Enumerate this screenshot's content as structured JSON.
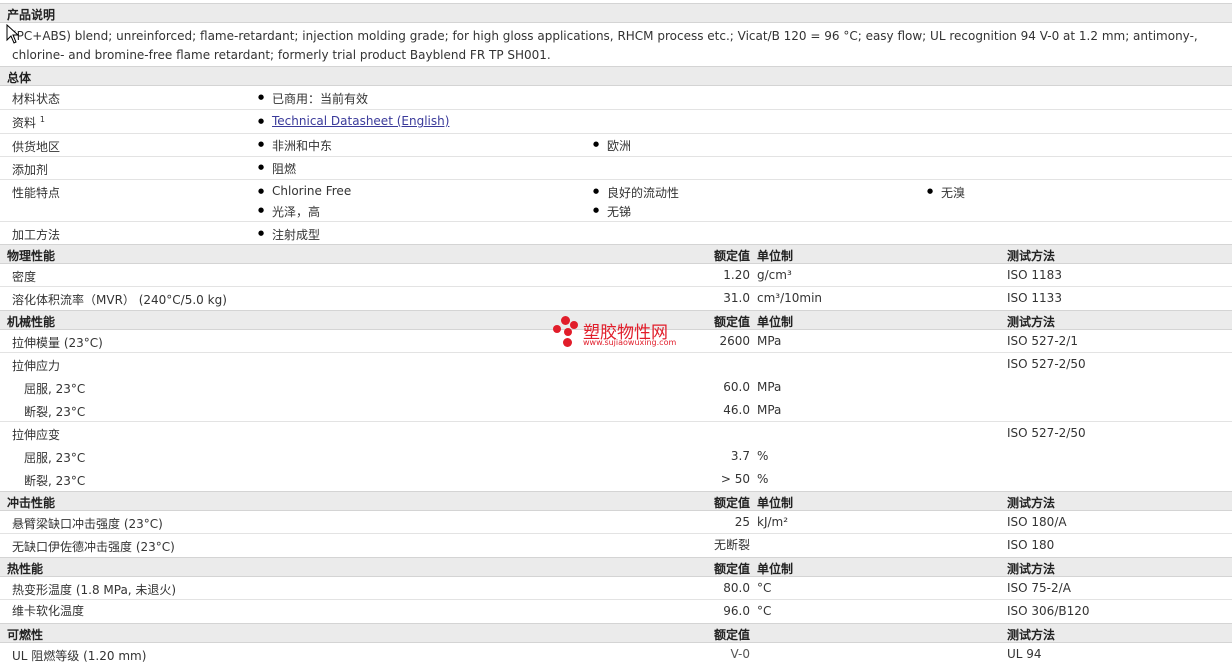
{
  "sections": {
    "desc_title": "产品说明",
    "desc_text": "(PC+ABS) blend; unreinforced; flame-retardant; injection molding grade; for high gloss applications, RHCM process etc.; Vicat/B 120 = 96 °C; easy flow; UL recognition 94 V-0 at 1.2 mm; antimony-, chlorine- and bromine-free flame retardant; formerly trial product Bayblend FR TP SH001.",
    "general_title": "总体",
    "physical_title": "物理性能",
    "mechanical_title": "机械性能",
    "impact_title": "冲击性能",
    "thermal_title": "热性能",
    "flammability_title": "可燃性"
  },
  "headers": {
    "value": "额定值",
    "unit": "单位制",
    "method": "测试方法"
  },
  "general": {
    "material_status_label": "材料状态",
    "material_status": "已商用：当前有效",
    "docs_label": "资料",
    "docs_sup": "1",
    "docs_link": "Technical Datasheet (English)",
    "region_label": "供货地区",
    "region_1": "非洲和中东",
    "region_2": "欧洲",
    "additive_label": "添加剂",
    "additive": "阻燃",
    "features_label": "性能特点",
    "feature_1": "Chlorine Free",
    "feature_2": "良好的流动性",
    "feature_3": "无溴",
    "feature_4": "光泽，高",
    "feature_5": "无锑",
    "processing_label": "加工方法",
    "processing": "注射成型"
  },
  "physical": [
    {
      "label": "密度",
      "value": "1.20",
      "unit": "g/cm³",
      "method": "ISO 1183"
    },
    {
      "label": "溶化体积流率（MVR） (240°C/5.0 kg)",
      "value": "31.0",
      "unit": "cm³/10min",
      "method": "ISO 1133"
    }
  ],
  "mechanical": [
    {
      "label": "拉伸模量 (23°C)",
      "value": "2600",
      "unit": "MPa",
      "method": "ISO 527-2/1"
    },
    {
      "label": "拉伸应力",
      "value": "",
      "unit": "",
      "method": "ISO 527-2/50"
    },
    {
      "label": "屈服, 23°C",
      "value": "60.0",
      "unit": "MPa",
      "method": ""
    },
    {
      "label": "断裂, 23°C",
      "value": "46.0",
      "unit": "MPa",
      "method": ""
    },
    {
      "label": "拉伸应变",
      "value": "",
      "unit": "",
      "method": "ISO 527-2/50"
    },
    {
      "label": "屈服, 23°C",
      "value": "3.7",
      "unit": "%",
      "method": ""
    },
    {
      "label": "断裂, 23°C",
      "value": "> 50",
      "unit": "%",
      "method": ""
    }
  ],
  "impact": [
    {
      "label": "悬臂梁缺口冲击强度 (23°C)",
      "value": "25",
      "unit": "kJ/m²",
      "method": "ISO 180/A"
    },
    {
      "label": "无缺口伊佐德冲击强度 (23°C)",
      "value": "无断裂",
      "unit": "",
      "method": "ISO 180"
    }
  ],
  "thermal": [
    {
      "label": "热变形温度 (1.8 MPa, 未退火)",
      "value": "80.0",
      "unit": "°C",
      "method": "ISO 75-2/A"
    },
    {
      "label": "维卡软化温度",
      "value": "96.0",
      "unit": "°C",
      "method": "ISO 306/B120"
    }
  ],
  "flammability": [
    {
      "label": "UL 阻燃等级 (1.20 mm)",
      "value": "V-0",
      "unit": "",
      "method": "UL 94"
    }
  ],
  "watermark": {
    "name": "塑胶物性网",
    "url": "www.sujiaowuxing.com"
  },
  "colors": {
    "header_bg": "#ebebeb",
    "watermark": "#e11d2a",
    "link": "#3a3a9a"
  }
}
